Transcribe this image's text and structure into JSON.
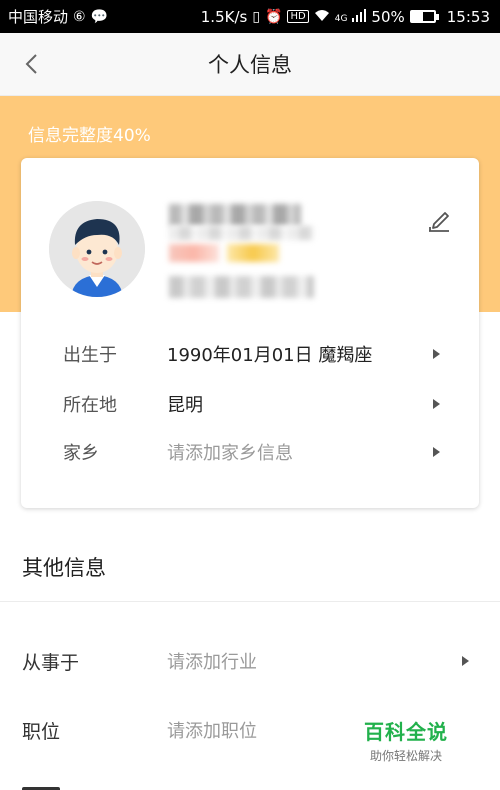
{
  "status_bar": {
    "carrier": "中国移动",
    "speed": "1.5K/s",
    "hd": "HD",
    "network": "4G",
    "battery": "50%",
    "battery_level": 0.5,
    "time": "15:53"
  },
  "nav": {
    "title": "个人信息",
    "back_icon": "chevron-left-icon"
  },
  "header": {
    "completion": "信息完整度40%",
    "background_color": "#fec97a"
  },
  "profile": {
    "avatar_icon": "cartoon-boy-avatar",
    "edit_icon": "pencil-edit-icon",
    "rows": [
      {
        "label": "出生于",
        "value": "1990年01月01日  魔羯座",
        "is_placeholder": false
      },
      {
        "label": "所在地",
        "value": "昆明",
        "is_placeholder": false
      },
      {
        "label": "家乡",
        "value": "请添加家乡信息",
        "is_placeholder": true
      }
    ]
  },
  "other_info": {
    "title": "其他信息",
    "rows": [
      {
        "label": "从事于",
        "value": "请添加行业",
        "has_arrow": true
      },
      {
        "label": "职位",
        "value": "请添加职位",
        "has_arrow": false
      }
    ]
  },
  "watermark": {
    "name": "百科全说",
    "slogan": "助你轻松解决"
  }
}
